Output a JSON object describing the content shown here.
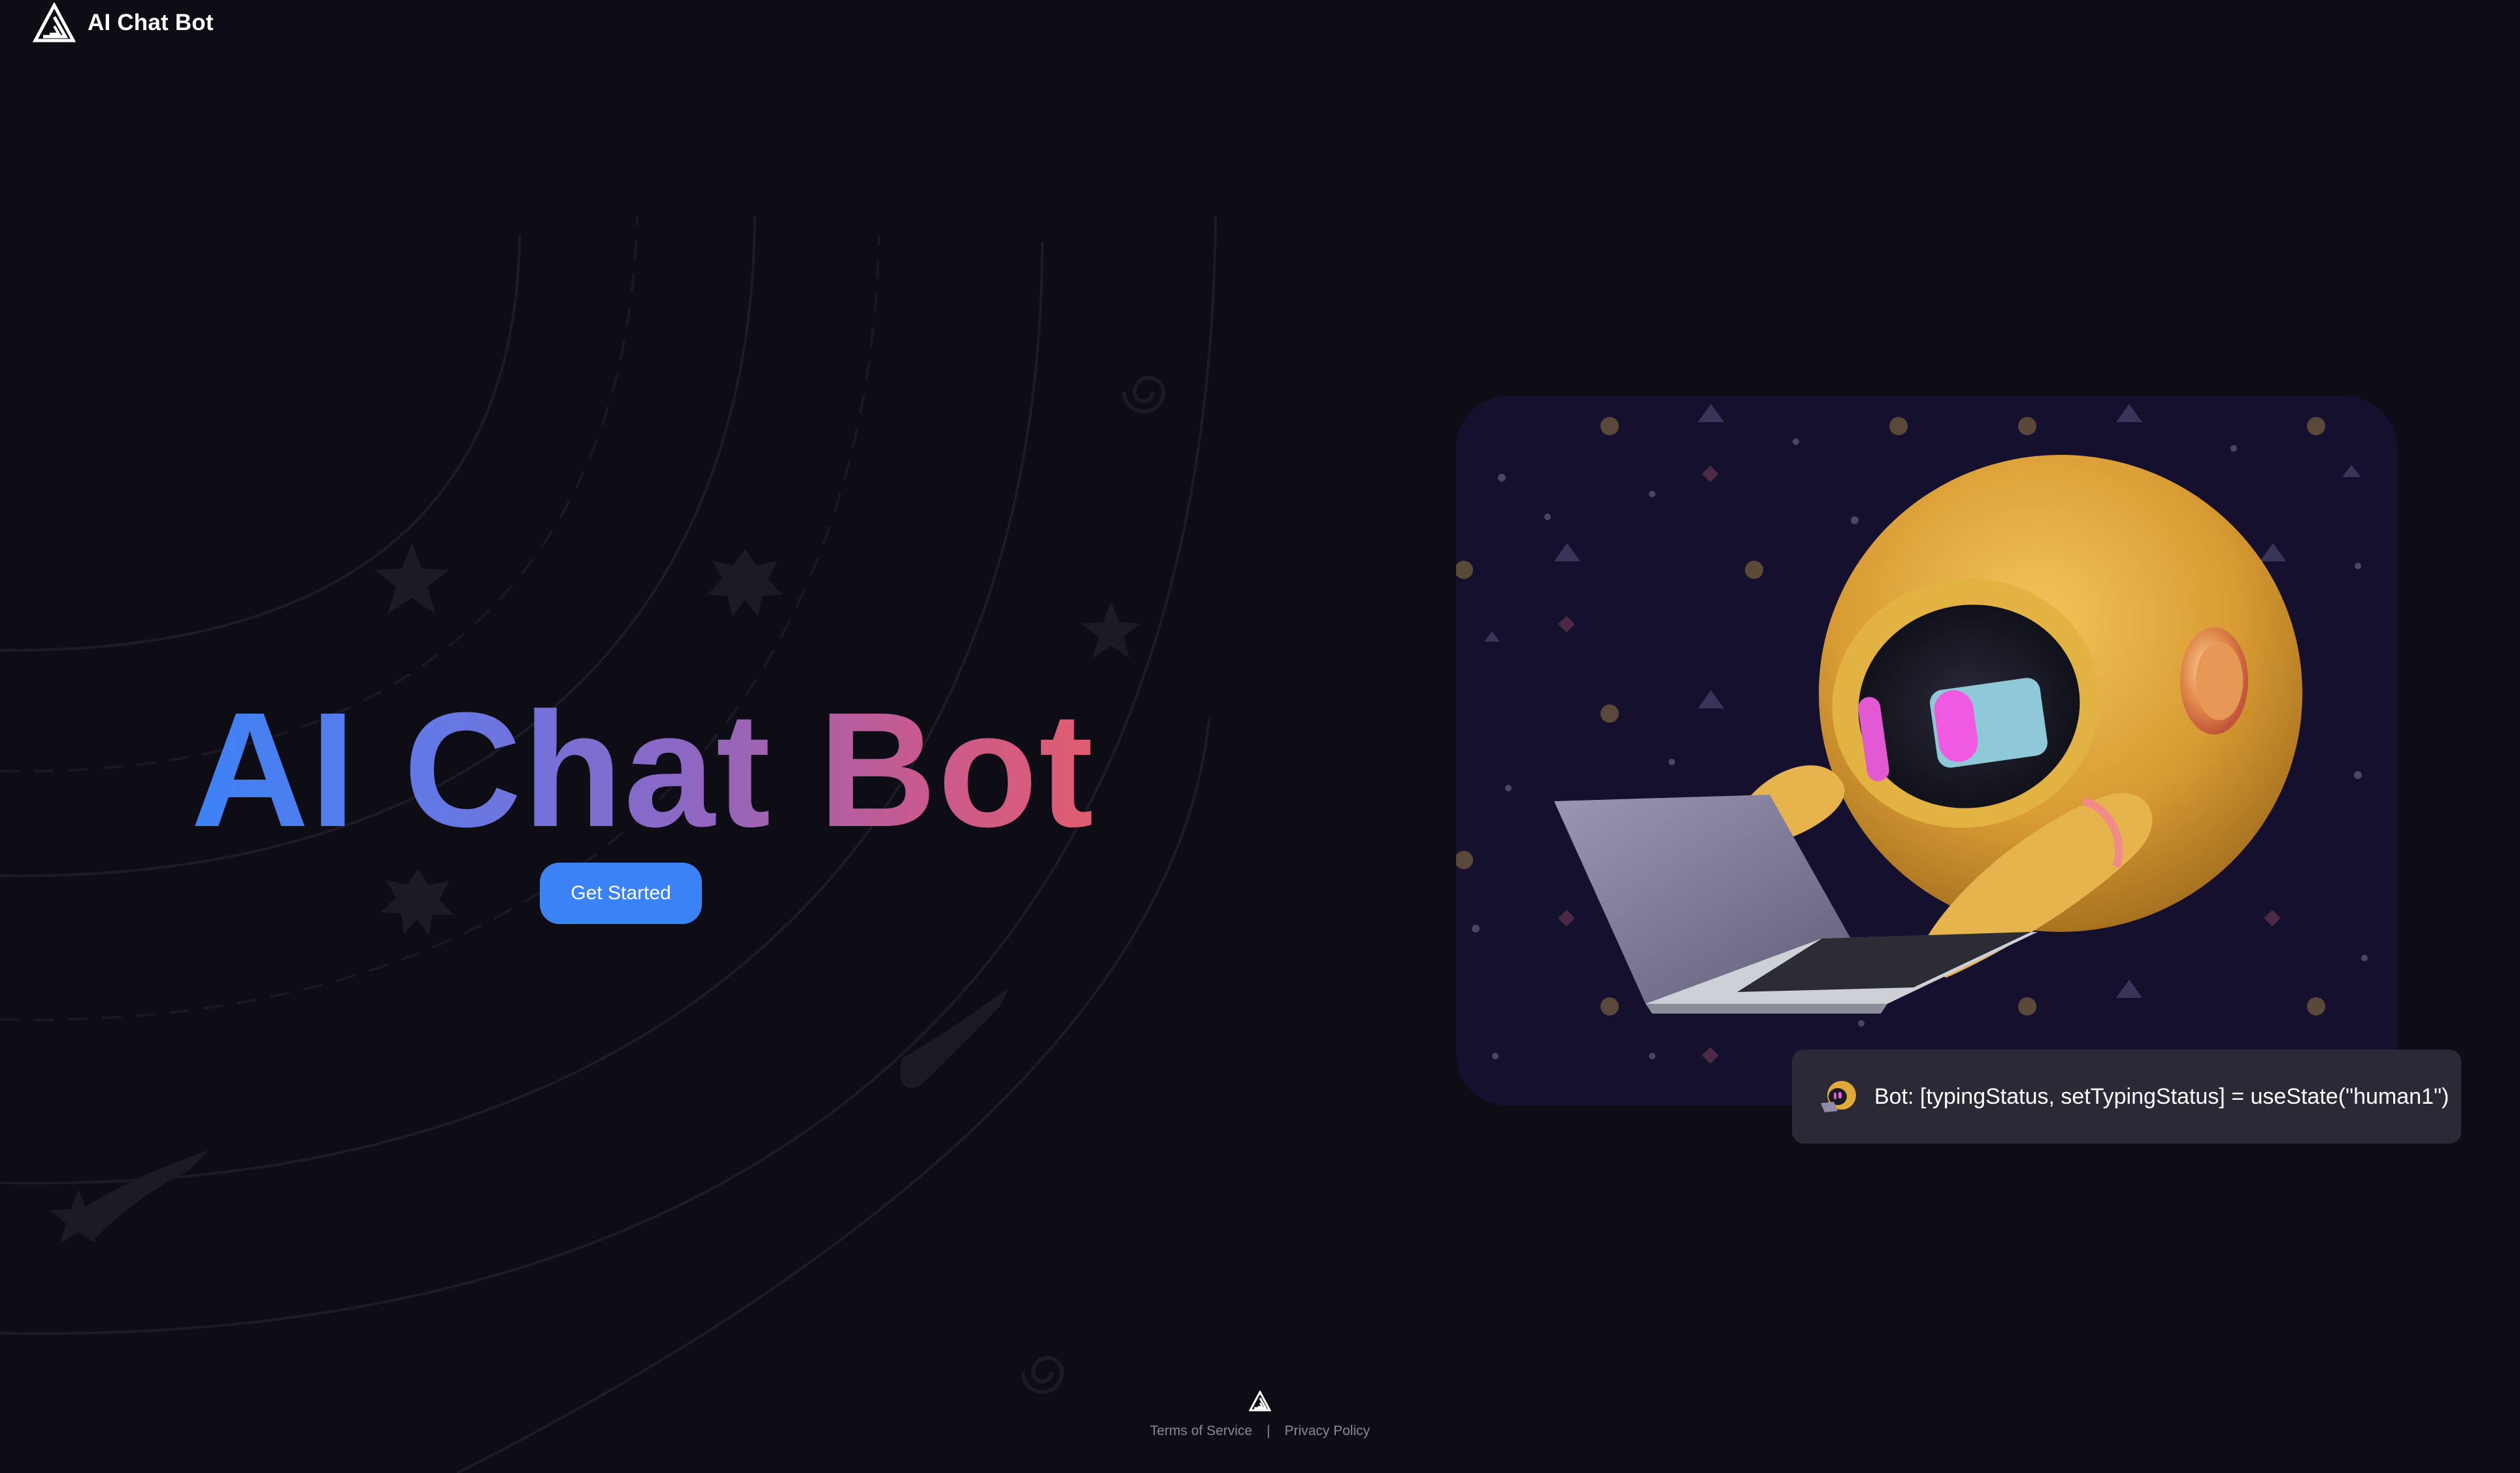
{
  "header": {
    "logo_icon": "triangle-logo-icon",
    "app_name": "AI Chat Bot"
  },
  "hero": {
    "title": "AI Chat Bot",
    "gradient_colors": [
      "#3b82f6",
      "#8d67c3",
      "#e05d6f"
    ],
    "cta_label": "Get Started",
    "cta_color": "#3b82f6"
  },
  "illustration": {
    "icon": "robot-with-laptop-illustration",
    "background_color": "#15102e",
    "robot_color": "#e0a93a"
  },
  "chat": {
    "avatar_icon": "bot-avatar-icon",
    "message": "Bot: [typingStatus, setTypingStatus] = useState(\"human1\")"
  },
  "footer": {
    "logo_icon": "triangle-logo-icon",
    "terms_label": "Terms of Service",
    "separator": "|",
    "privacy_label": "Privacy Policy"
  },
  "colors": {
    "page_background": "#0e0c15",
    "bubble_background": "#2c2937",
    "footer_text": "#8a8894"
  }
}
